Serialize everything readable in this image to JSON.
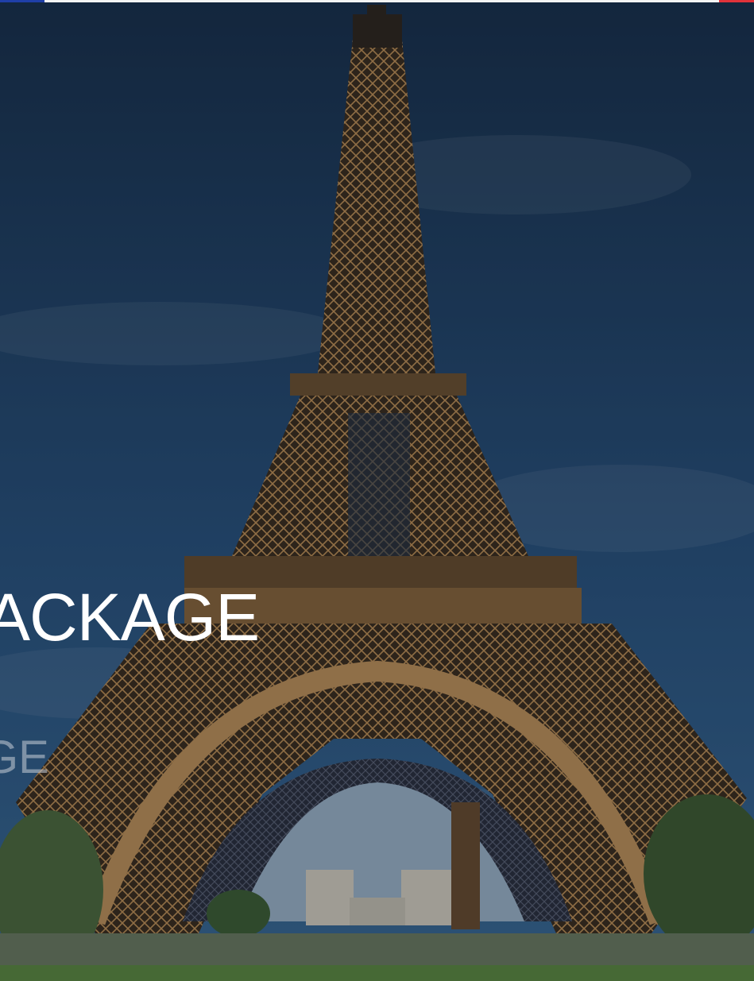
{
  "hero": {
    "image": "eiffel-tower-photo",
    "title": "ACKAGE",
    "subtitle": "GE"
  },
  "colors": {
    "sky_top": "#1c3452",
    "sky_bottom": "#2f5a85",
    "tower": "#a7793e",
    "flag_blue": "#1f3fa8",
    "flag_white": "#f4f4f4",
    "flag_red": "#e0323a"
  }
}
